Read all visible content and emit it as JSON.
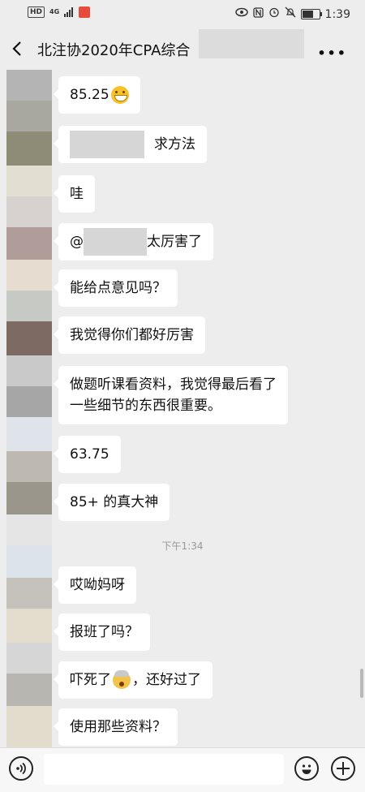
{
  "status_bar": {
    "hd": "HD",
    "network": "4G",
    "time": "1:39",
    "icons": [
      "eye-icon",
      "nfc-icon",
      "alarm-icon",
      "mute-icon",
      "battery-icon"
    ]
  },
  "header": {
    "title": "北注协2020年CPA综合",
    "back_icon": "back-arrow-icon",
    "more_icon": "more-icon"
  },
  "messages": [
    {
      "text": "85.25",
      "emoji": "grinning-face-icon"
    },
    {
      "text": "求方法",
      "redacted_prefix": true
    },
    {
      "text": "哇"
    },
    {
      "text_before": "@",
      "text_after": " 太厉害了",
      "redacted_mention": true
    },
    {
      "text": "能给点意见吗？"
    },
    {
      "text": "我觉得你们都好厉害"
    },
    {
      "line1": "做题听课看资料，我觉得最后看了",
      "line2": "一些细节的东西很重要。"
    },
    {
      "text": "63.75"
    },
    {
      "text": "85+ 的真大神"
    },
    {
      "text": "哎呦妈呀"
    },
    {
      "text": "报班了吗？"
    },
    {
      "text_before": "吓死了",
      "text_after": "，还好过了",
      "emoji": "exploding-head-icon"
    },
    {
      "text": "使用那些资料？"
    }
  ],
  "timestamp": "下午1:34",
  "input_bar": {
    "voice_icon": "voice-icon",
    "emoji_icon": "emoji-icon",
    "plus_icon": "plus-icon",
    "input_value": ""
  },
  "colors": {
    "background": "#ededed",
    "bubble": "#ffffff",
    "status_app": "#e64b3c"
  }
}
